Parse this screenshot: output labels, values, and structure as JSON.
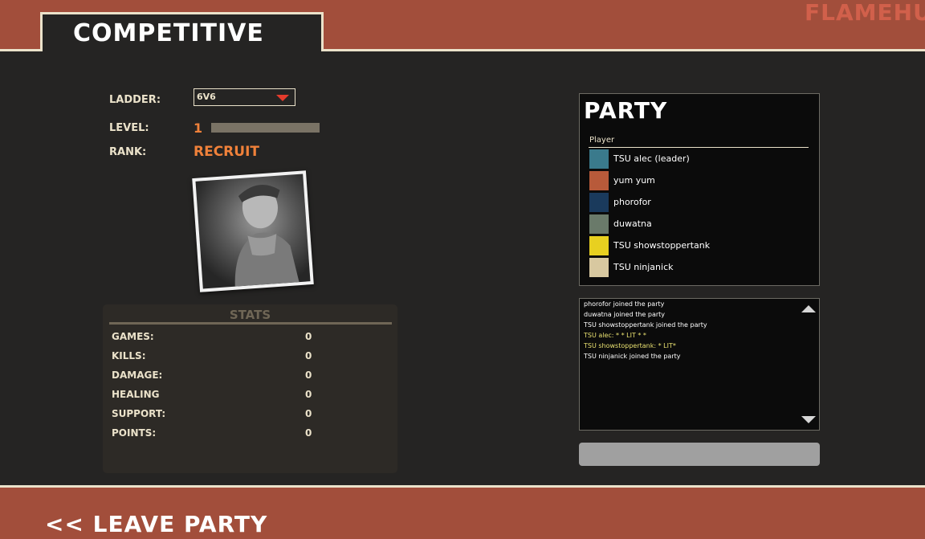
{
  "header": {
    "title": "COMPETITIVE",
    "brand": "FLAMEHU"
  },
  "ladder": {
    "label": "LADDER:",
    "selected": "6V6"
  },
  "level": {
    "label": "LEVEL:",
    "value": "1",
    "progress": 0
  },
  "rank": {
    "label": "RANK:",
    "value": "RECRUIT"
  },
  "stats": {
    "title": "STATS",
    "rows": [
      {
        "label": "GAMES:",
        "value": "0"
      },
      {
        "label": "KILLS:",
        "value": "0"
      },
      {
        "label": "DAMAGE:",
        "value": "0"
      },
      {
        "label": "HEALING",
        "value": "0"
      },
      {
        "label": "SUPPORT:",
        "value": "0"
      },
      {
        "label": "POINTS:",
        "value": "0"
      }
    ]
  },
  "party": {
    "title": "PARTY",
    "column_header": "Player",
    "players": [
      {
        "name": "TSU alec (leader)",
        "avatar_color": "#3a7a8c"
      },
      {
        "name": "yum yum",
        "avatar_color": "#b85a3a"
      },
      {
        "name": "phorofor",
        "avatar_color": "#1a3a5c"
      },
      {
        "name": "duwatna",
        "avatar_color": "#6a7a6a"
      },
      {
        "name": "TSU showstoppertank",
        "avatar_color": "#e8d020"
      },
      {
        "name": "TSU ninjanick",
        "avatar_color": "#d8c8a0"
      }
    ]
  },
  "chat": {
    "messages": [
      {
        "text": "phorofor joined the party",
        "color": "#ffffff"
      },
      {
        "text": "duwatna joined the party",
        "color": "#ffffff"
      },
      {
        "text": "TSU showstoppertank joined the party",
        "color": "#ffffff"
      },
      {
        "text": "TSU alec: * * LIT * *",
        "color": "#e8e070"
      },
      {
        "text": "TSU showstoppertank: * LIT*",
        "color": "#e8e070"
      },
      {
        "text": "TSU ninjanick joined the party",
        "color": "#ffffff"
      }
    ]
  },
  "footer": {
    "leave_label": "<< LEAVE PARTY"
  },
  "colors": {
    "accent": "#a24e3b",
    "highlight": "#f0813a",
    "text": "#ebe2ca"
  }
}
